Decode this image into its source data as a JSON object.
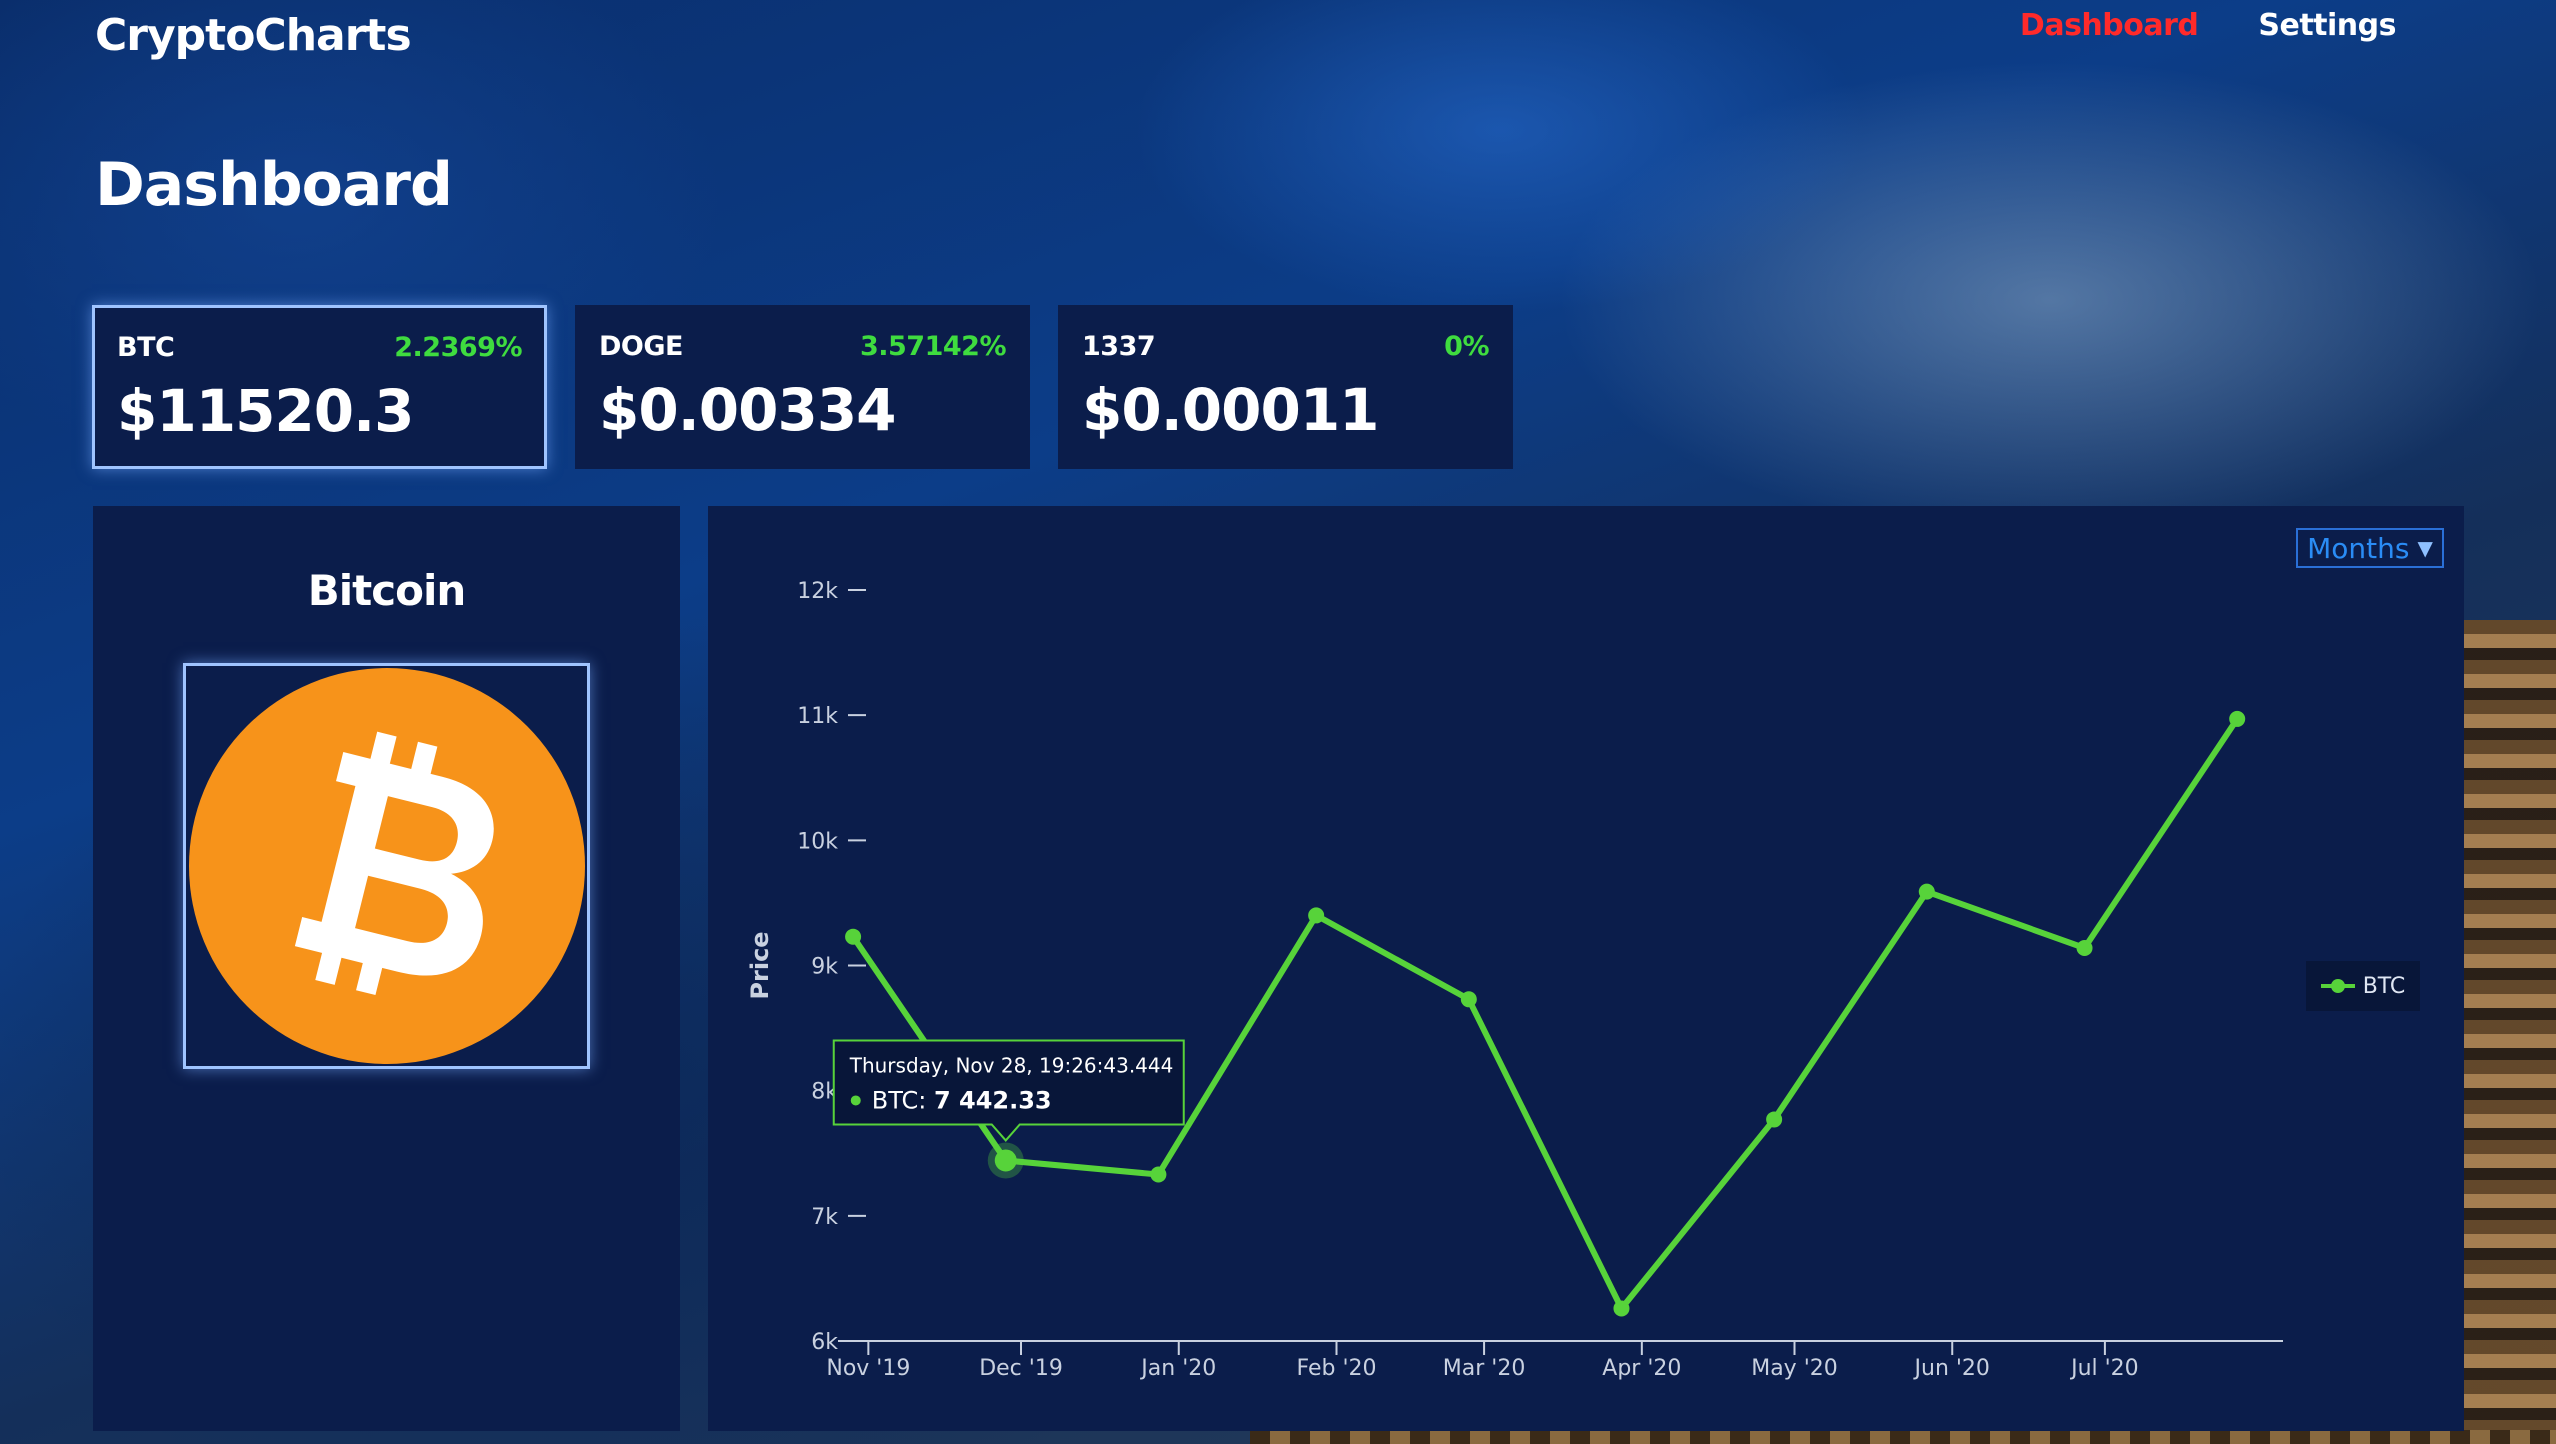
{
  "app": {
    "brand": "CryptoCharts"
  },
  "nav": {
    "items": [
      {
        "label": "Dashboard",
        "active": true
      },
      {
        "label": "Settings",
        "active": false
      }
    ]
  },
  "page": {
    "title": "Dashboard"
  },
  "cards": [
    {
      "symbol": "BTC",
      "change": "2.2369%",
      "price": "$11520.3",
      "selected": true
    },
    {
      "symbol": "DOGE",
      "change": "3.57142%",
      "price": "$0.00334",
      "selected": false
    },
    {
      "symbol": "1337",
      "change": "0%",
      "price": "$0.00011",
      "selected": false
    }
  ],
  "coin_panel": {
    "name": "Bitcoin",
    "logo_icon": "bitcoin-logo-icon"
  },
  "chart_controls": {
    "period": "Months"
  },
  "colors": {
    "line": "#57d33a",
    "panel": "#0b1d4b",
    "accent_red": "#ff2a2a",
    "positive": "#3fdc3f",
    "bitcoin_orange": "#f7931a"
  },
  "tooltip": {
    "date": "Thursday, Nov 28, 19:26:43.444",
    "series": "BTC",
    "value": "7 442.33"
  },
  "chart_data": {
    "type": "line",
    "ylabel": "Price",
    "ylim": [
      6000,
      12000
    ],
    "y_ticks": [
      6000,
      7000,
      8000,
      9000,
      10000,
      11000,
      12000
    ],
    "y_tick_labels": [
      "6k",
      "7k",
      "8k",
      "9k",
      "10k",
      "11k",
      "12k"
    ],
    "x_ticks": [
      "2019-11-01",
      "2019-12-01",
      "2020-01-01",
      "2020-02-01",
      "2020-03-01",
      "2020-04-01",
      "2020-05-01",
      "2020-06-01",
      "2020-07-01"
    ],
    "x_tick_labels": [
      "Nov '19",
      "Dec '19",
      "Jan '20",
      "Feb '20",
      "Mar '20",
      "Apr '20",
      "May '20",
      "Jun '20",
      "Jul '20"
    ],
    "xlim": [
      "2019-10-28",
      "2020-08-05"
    ],
    "series": [
      {
        "name": "BTC",
        "points": [
          {
            "x": "2019-10-29",
            "y": 9230
          },
          {
            "x": "2019-11-28",
            "y": 7442.33
          },
          {
            "x": "2019-12-28",
            "y": 7330
          },
          {
            "x": "2020-01-28",
            "y": 9400
          },
          {
            "x": "2020-02-27",
            "y": 8730
          },
          {
            "x": "2020-03-28",
            "y": 6260
          },
          {
            "x": "2020-04-27",
            "y": 7770
          },
          {
            "x": "2020-05-27",
            "y": 9590
          },
          {
            "x": "2020-06-27",
            "y": 9140
          },
          {
            "x": "2020-07-27",
            "y": 10970
          }
        ]
      }
    ],
    "highlighted_point": 1,
    "legend": {
      "position": "right",
      "entries": [
        "BTC"
      ]
    }
  }
}
